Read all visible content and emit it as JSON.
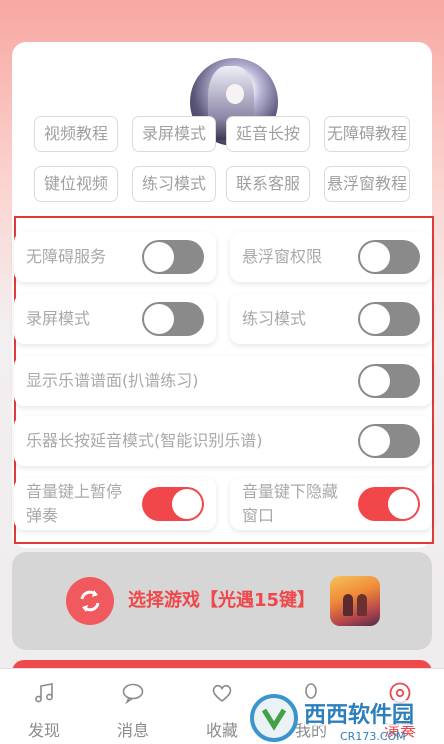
{
  "tags": [
    {
      "label": "视频教程"
    },
    {
      "label": "录屏模式"
    },
    {
      "label": "延音长按"
    },
    {
      "label": "无障碍教程"
    },
    {
      "label": "键位视频"
    },
    {
      "label": "练习模式"
    },
    {
      "label": "联系客服"
    },
    {
      "label": "悬浮窗教程"
    }
  ],
  "settings": [
    {
      "label": "无障碍服务",
      "on": false
    },
    {
      "label": "悬浮窗权限",
      "on": false
    },
    {
      "label": "录屏模式",
      "on": false
    },
    {
      "label": "练习模式",
      "on": false
    },
    {
      "label": "显示乐谱谱面(扒谱练习)",
      "on": false
    },
    {
      "label": "乐器长按延音模式(智能识别乐谱)",
      "on": false
    },
    {
      "label": "音量键上暂停弹奏",
      "on": true
    },
    {
      "label": "音量键下隐藏窗口",
      "on": true
    }
  ],
  "game": {
    "label": "选择游戏【光遇15键】"
  },
  "tabs": [
    {
      "label": "发现",
      "icon": "music-note-icon"
    },
    {
      "label": "消息",
      "icon": "chat-bubble-icon"
    },
    {
      "label": "收藏",
      "icon": "heart-icon"
    },
    {
      "label": "我的",
      "icon": "person-icon"
    },
    {
      "label": "演奏",
      "icon": "disc-icon"
    }
  ],
  "watermark": {
    "text": "西西软件园",
    "sub": "CR173.COM"
  },
  "colors": {
    "accent": "#f2474a",
    "switch_off": "#8a8a8a",
    "highlight_border": "#e23a3a"
  }
}
